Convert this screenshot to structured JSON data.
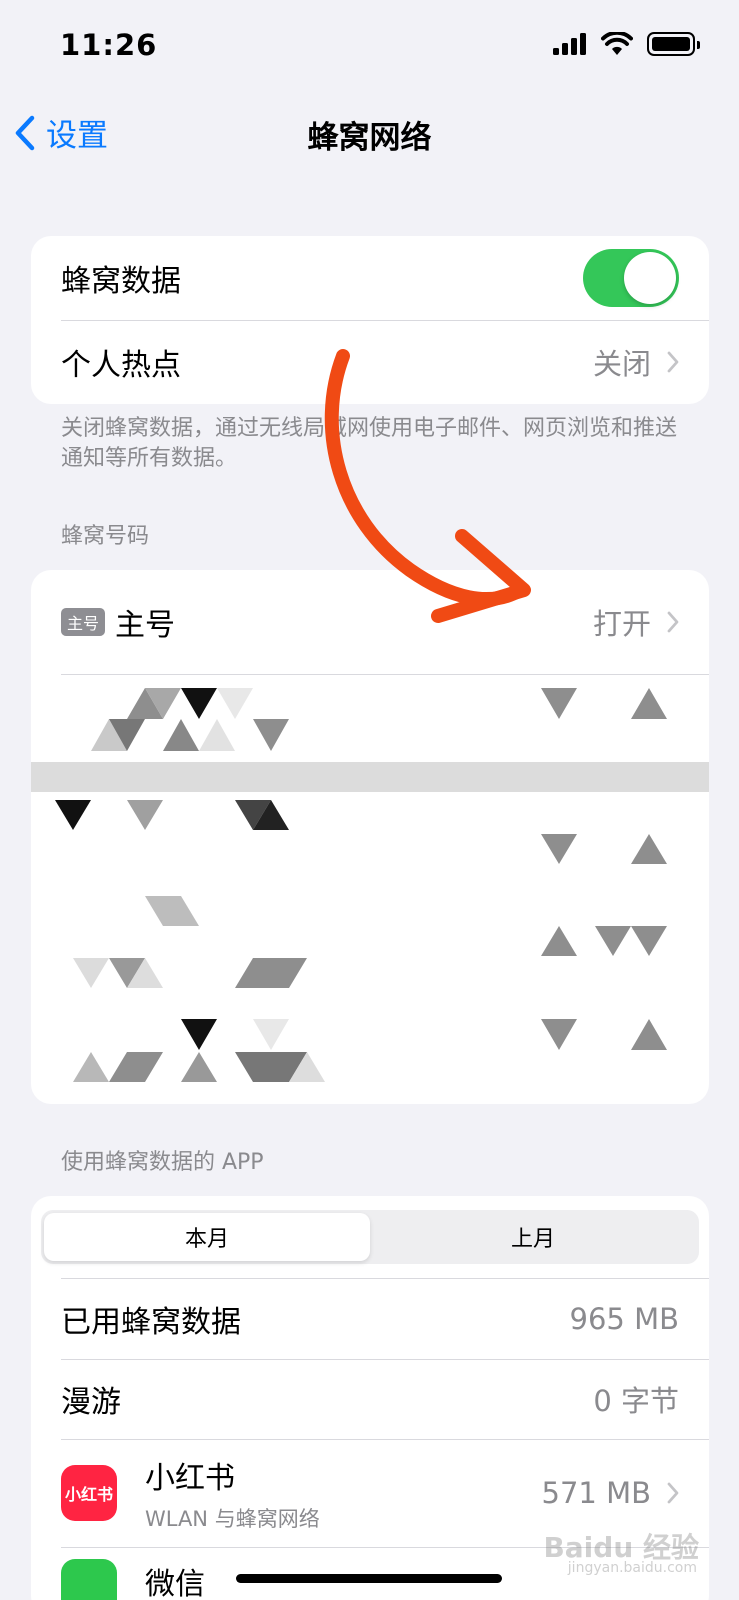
{
  "status_bar": {
    "time": "11:26"
  },
  "nav": {
    "back_label": "设置",
    "title": "蜂窝网络"
  },
  "section1": {
    "rows": [
      {
        "label": "蜂窝数据",
        "toggle_on": true
      },
      {
        "label": "个人热点",
        "value": "关闭"
      }
    ],
    "footnote": "关闭蜂窝数据，通过无线局域网使用电子邮件、网页浏览和推送通知等所有数据。"
  },
  "section2": {
    "header": "蜂窝号码",
    "sim": {
      "badge": "主号",
      "label": "主号",
      "value": "打开"
    }
  },
  "section3": {
    "header": "使用蜂窝数据的 APP",
    "segments": [
      "本月",
      "上月"
    ],
    "active_segment": "本月",
    "used": {
      "label": "已用蜂窝数据",
      "value": "965 MB"
    },
    "roaming": {
      "label": "漫游",
      "value": "0 字节"
    },
    "apps": [
      {
        "icon_text": "小红书",
        "name": "小红书",
        "sub": "WLAN 与蜂窝网络",
        "value": "571 MB"
      },
      {
        "name": "微信"
      }
    ]
  },
  "watermark": {
    "text": "Baidu 经验",
    "sub": "jingyan.baidu.com"
  },
  "colors": {
    "accent": "#0a7aff",
    "toggle_on": "#34c759",
    "annotation_arrow": "#f04a14",
    "app_icon": "#ff2442"
  }
}
